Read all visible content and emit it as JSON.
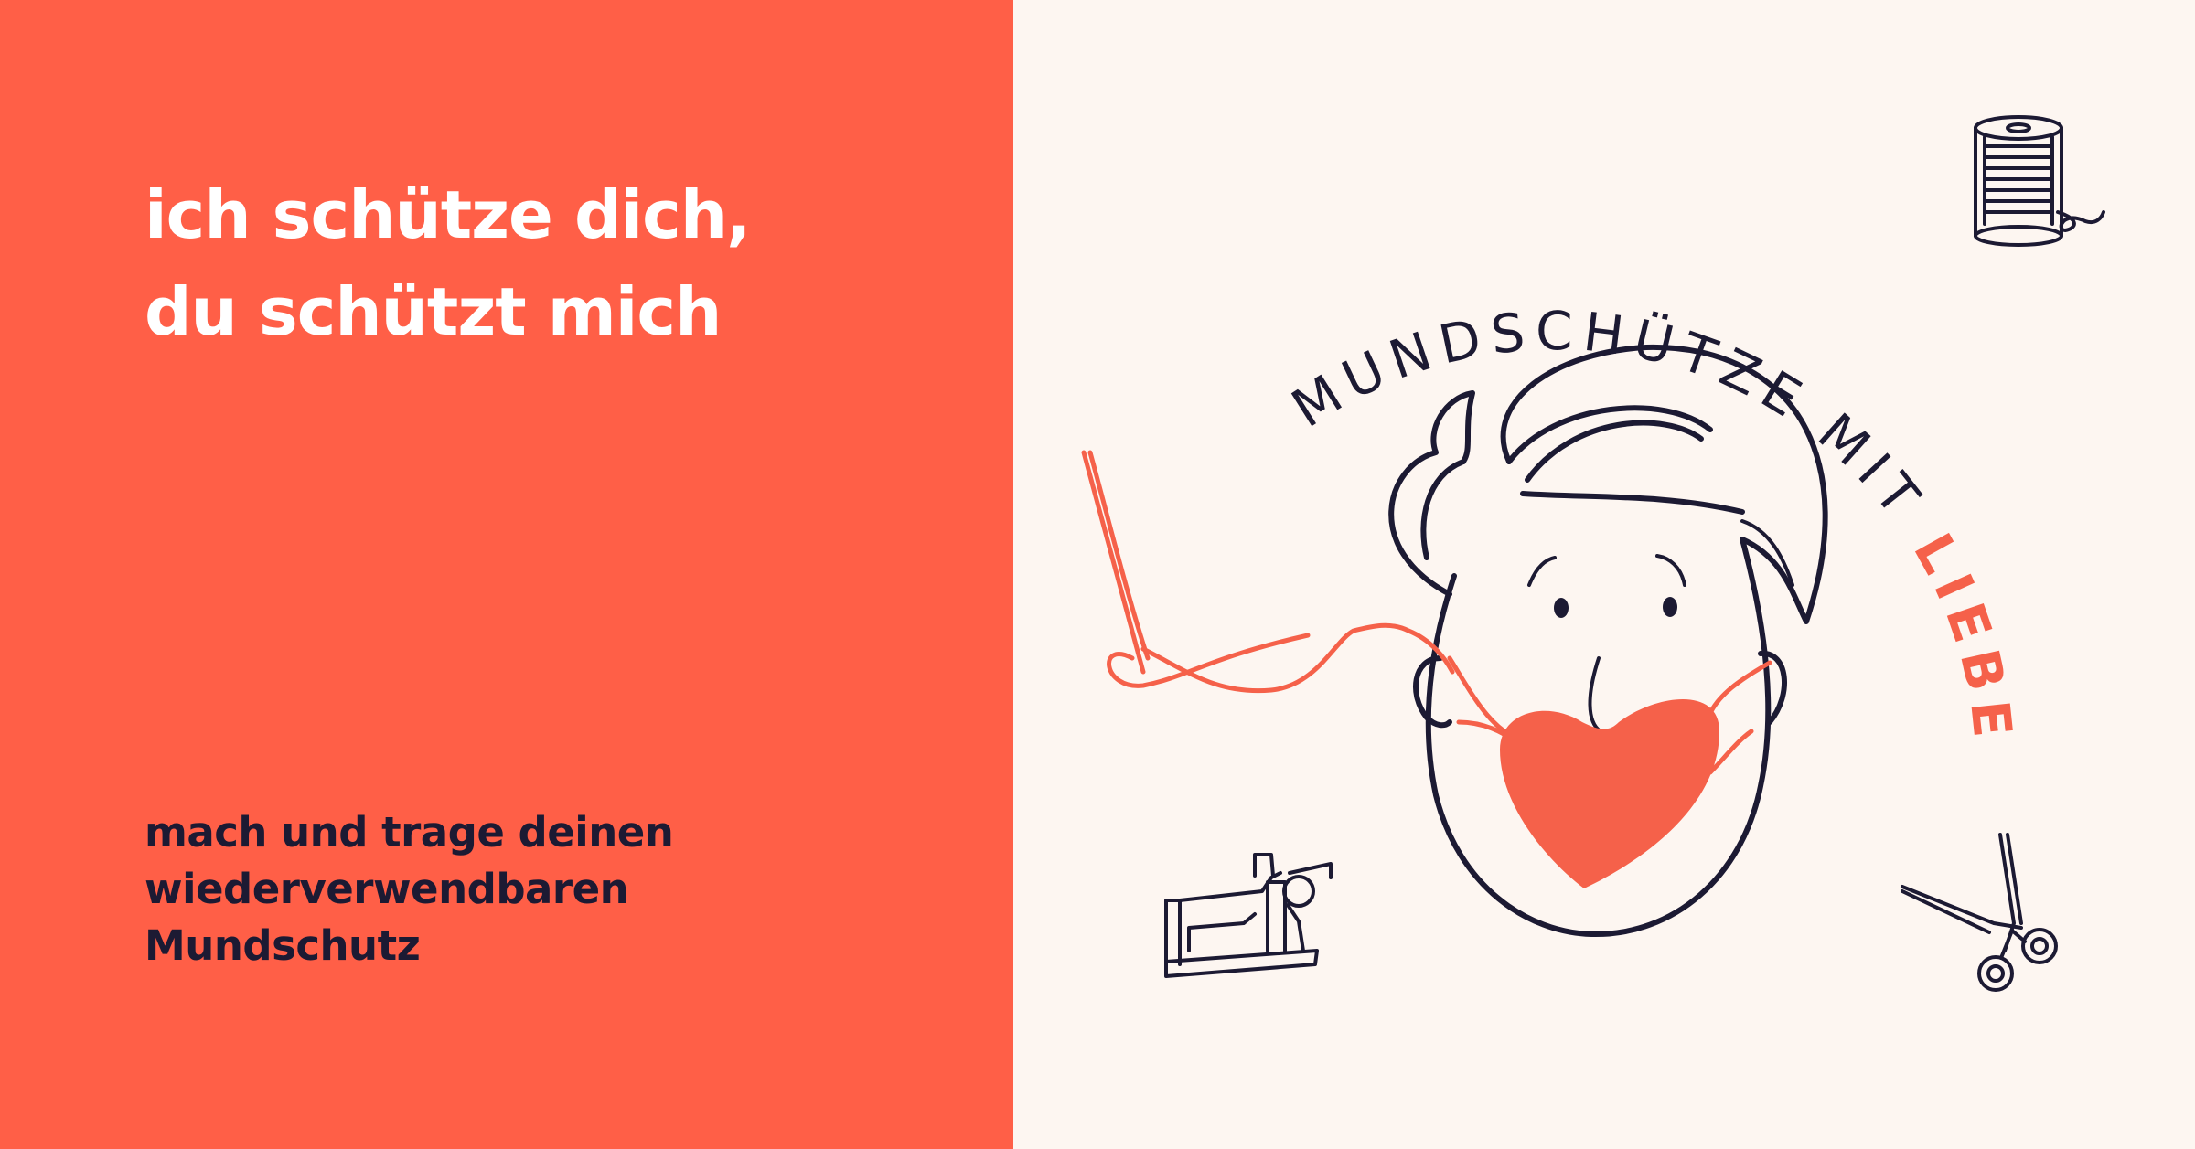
{
  "left": {
    "headline_lines": [
      "ich schütze dich,",
      "du schützt mich"
    ],
    "subline_lines": [
      "mach und trage deinen",
      "wiederverwendbaren",
      "Mundschutz"
    ]
  },
  "logo": {
    "arc_text_dark": "MUNDSCHÜTZE MIT ",
    "arc_text_red": "LIEBE"
  },
  "icons": [
    "needle-icon",
    "thread-spool-icon",
    "sewing-machine-icon",
    "scissors-icon"
  ],
  "colors": {
    "accent": "#ff5f47",
    "ink": "#1c1a33",
    "background": "#fdf6f1",
    "text_light": "#ffffff"
  }
}
